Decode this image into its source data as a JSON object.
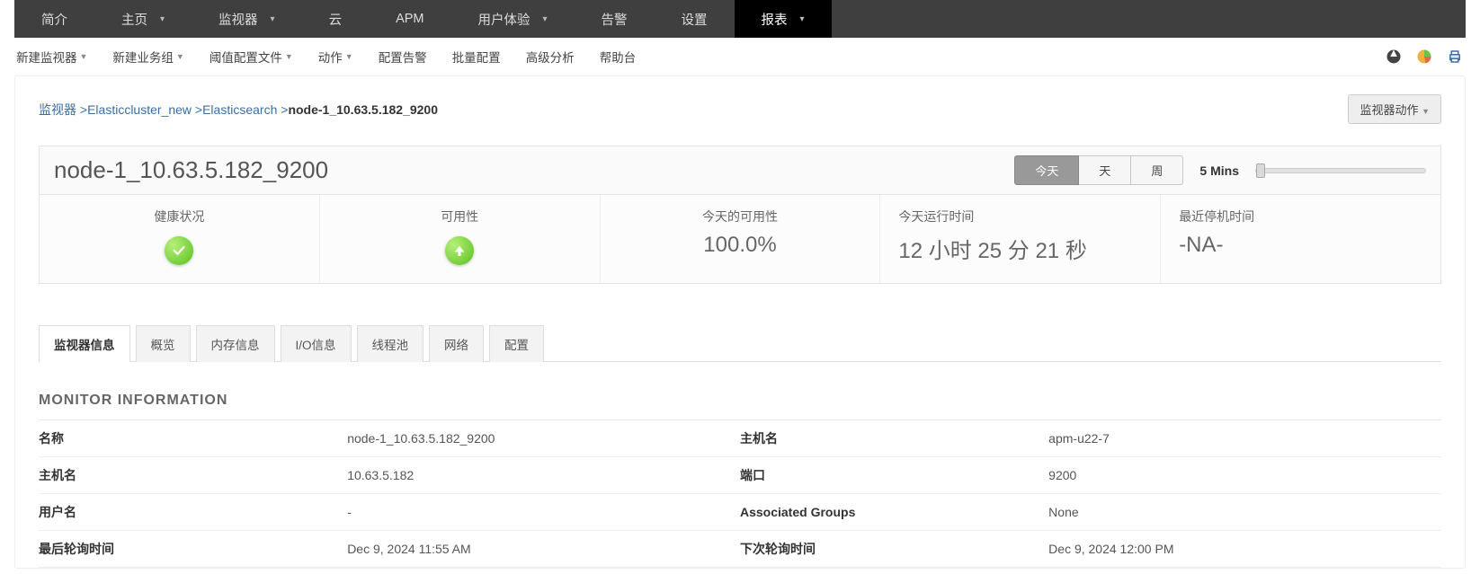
{
  "topnav": {
    "items": [
      {
        "label": "简介",
        "chev": false
      },
      {
        "label": "主页",
        "chev": true
      },
      {
        "label": "监视器",
        "chev": true
      },
      {
        "label": "云",
        "chev": false
      },
      {
        "label": "APM",
        "chev": false
      },
      {
        "label": "用户体验",
        "chev": true
      },
      {
        "label": "告警",
        "chev": false
      },
      {
        "label": "设置",
        "chev": false
      },
      {
        "label": "报表",
        "chev": true,
        "active": true
      }
    ]
  },
  "subnav": {
    "items": [
      {
        "label": "新建监视器",
        "caret": true
      },
      {
        "label": "新建业务组",
        "caret": true
      },
      {
        "label": "阈值配置文件",
        "caret": true
      },
      {
        "label": "动作",
        "caret": true
      },
      {
        "label": "配置告警",
        "caret": false
      },
      {
        "label": "批量配置",
        "caret": false
      },
      {
        "label": "高级分析",
        "caret": false
      },
      {
        "label": "帮助台",
        "caret": false
      }
    ]
  },
  "breadcrumb": {
    "parts": [
      "监视器",
      "Elasticcluster_new",
      "Elasticsearch"
    ],
    "current": "node-1_10.63.5.182_9200",
    "action_label": "监视器动作"
  },
  "title": "node-1_10.63.5.182_9200",
  "segment": {
    "options": [
      "今天",
      "天",
      "周"
    ],
    "active": 0
  },
  "interval": "5 Mins",
  "stats": {
    "health": {
      "label": "健康状况"
    },
    "avail": {
      "label": "可用性"
    },
    "today_avail": {
      "label": "今天的可用性",
      "value": "100.0%"
    },
    "uptime": {
      "label": "今天运行时间",
      "value": "12 小时 25 分 21 秒"
    },
    "downtime": {
      "label": "最近停机时间",
      "value": "-NA-"
    }
  },
  "tabs": [
    "监视器信息",
    "概览",
    "内存信息",
    "I/O信息",
    "线程池",
    "网络",
    "配置"
  ],
  "active_tab": 0,
  "section_title": "MONITOR INFORMATION",
  "info_rows": [
    {
      "k1": "名称",
      "v1": "node-1_10.63.5.182_9200",
      "k2": "主机名",
      "v2": "apm-u22-7"
    },
    {
      "k1": "主机名",
      "v1": "10.63.5.182",
      "k2": "端口",
      "v2": "9200"
    },
    {
      "k1": "用户名",
      "v1": "-",
      "k2": "Associated Groups",
      "v2": "None"
    },
    {
      "k1": "最后轮询时间",
      "v1": "Dec 9, 2024 11:55 AM",
      "k2": "下次轮询时间",
      "v2": "Dec 9, 2024 12:00 PM"
    }
  ]
}
